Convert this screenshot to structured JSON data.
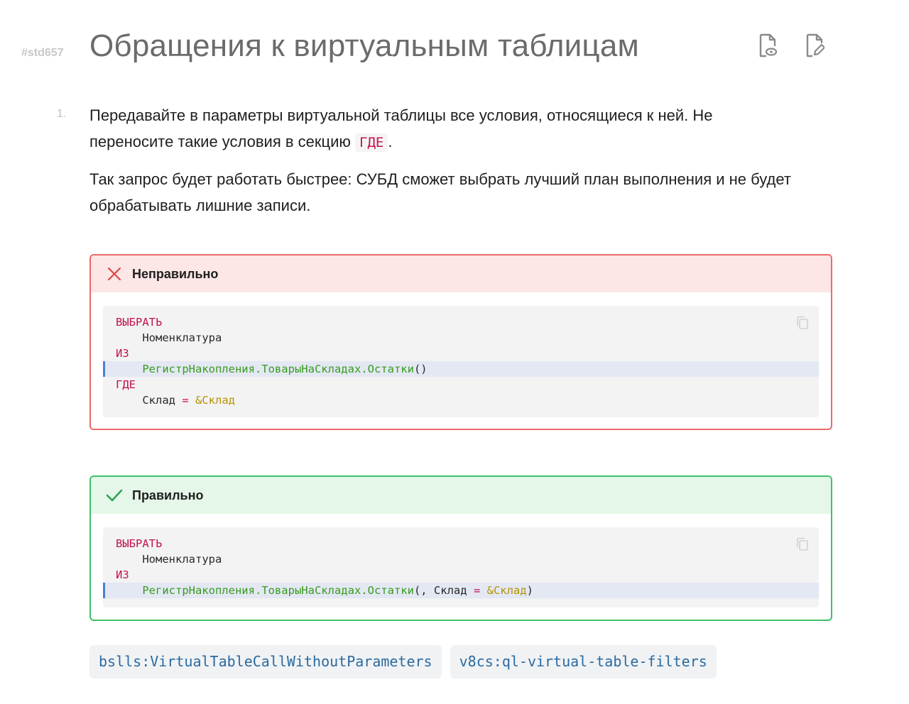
{
  "header": {
    "std_id": "#std657",
    "title": "Обращения к виртуальным таблицам"
  },
  "content": {
    "list_number": "1.",
    "para1_text": "Передавайте в параметры виртуальной таблицы все условия, относящиеся к ней. Не переносите такие условия в секцию ",
    "para1_code": "ГДЕ",
    "para1_end": ".",
    "para2": "Так запрос будет работать быстрее: СУБД сможет выбрать лучший план выполнения и не будет обрабатывать лишние записи."
  },
  "wrong_example": {
    "label": "Неправильно",
    "code": {
      "l1_kw": "ВЫБРАТЬ",
      "l2_id": "    Номенклатура",
      "l3_kw": "ИЗ",
      "l4_fn": "    РегистрНакопления.ТоварыНаСкладах.Остатки",
      "l4_paren": "()",
      "l5_kw": "ГДЕ",
      "l6_id": "    Склад ",
      "l6_op": "=",
      "l6_param": " &Склад"
    }
  },
  "right_example": {
    "label": "Правильно",
    "code": {
      "l1_kw": "ВЫБРАТЬ",
      "l2_id": "    Номенклатура",
      "l3_kw": "ИЗ",
      "l4_fn": "    РегистрНакопления.ТоварыНаСкладах.Остатки",
      "l4_args": "(, Склад ",
      "l4_op": "=",
      "l4_param": " &Склад",
      "l4_close": ")"
    }
  },
  "tags": [
    "bslls:VirtualTableCallWithoutParameters",
    "v8cs:ql-virtual-table-filters"
  ],
  "colors": {
    "wrong_border": "#ec6a6a",
    "wrong_bg": "#fde6e6",
    "right_border": "#3fc16a",
    "right_bg": "#e4f7e8",
    "keyword": "#c3124f",
    "function": "#3a9a1f",
    "parameter": "#b69200",
    "tag_text": "#2c6aa0"
  },
  "icons": {
    "preview": "file-eye-icon",
    "edit": "file-edit-icon",
    "wrong": "close-icon",
    "right": "check-icon",
    "copy": "copy-icon"
  }
}
